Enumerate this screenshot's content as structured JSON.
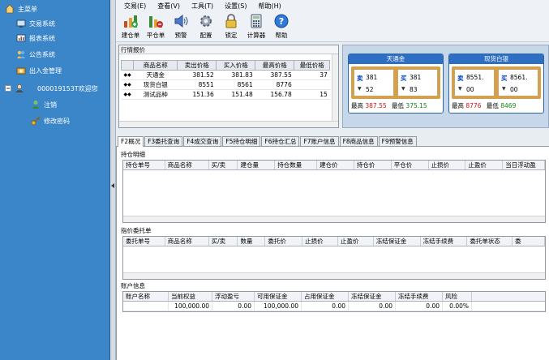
{
  "sidebar": {
    "items": [
      {
        "label": "主菜单"
      },
      {
        "label": "交易系统"
      },
      {
        "label": "报表系统"
      },
      {
        "label": "公告系统"
      },
      {
        "label": "出入金管理"
      },
      {
        "label": "000019153T欢迎您"
      },
      {
        "label": "注销"
      },
      {
        "label": "修改密码"
      }
    ]
  },
  "menu": {
    "items": [
      "交易(E)",
      "查看(V)",
      "工具(T)",
      "设置(S)",
      "帮助(H)"
    ]
  },
  "toolbar": {
    "buttons": [
      {
        "label": "建仓单"
      },
      {
        "label": "平仓单"
      },
      {
        "label": "预警"
      },
      {
        "label": "配置"
      },
      {
        "label": "锁定"
      },
      {
        "label": "计算器"
      },
      {
        "label": "帮助"
      }
    ]
  },
  "quotes": {
    "title": "行情报价",
    "headers": [
      "商品名称",
      "卖出价格",
      "买入价格",
      "最高价格",
      "最低价格"
    ],
    "rows": [
      {
        "mark": "◆◆",
        "name": "天通金",
        "sell": "381.52",
        "buy": "381.83",
        "high": "387.55",
        "low": "37"
      },
      {
        "mark": "◆◆",
        "name": "现货白银",
        "sell": "8551",
        "buy": "8561",
        "high": "8776",
        "low": ""
      },
      {
        "mark": "◆◆",
        "name": "测试品种",
        "sell": "151.36",
        "buy": "151.48",
        "high": "156.78",
        "low": "15"
      }
    ]
  },
  "cards": [
    {
      "title": "天通金",
      "sell_label": "卖",
      "sell": "381",
      "sell_vol": "52",
      "buy_label": "买",
      "buy": "381",
      "buy_vol": "83",
      "high_label": "最高",
      "high": "387.55",
      "low_label": "最低",
      "low": "375.15"
    },
    {
      "title": "现货白银",
      "sell_label": "卖",
      "sell": "8551.",
      "sell_vol": "00",
      "buy_label": "买",
      "buy": "8561.",
      "buy_vol": "00",
      "high_label": "最高",
      "high": "8776",
      "low_label": "最低",
      "low": "8469"
    }
  ],
  "tabs": [
    "F2概况",
    "F3委托查询",
    "F4成交查询",
    "F5持仓明细",
    "F6持仓汇总",
    "F7账户信息",
    "F8商品信息",
    "F9预警信息"
  ],
  "holdings": {
    "title": "持仓明细",
    "headers": [
      "持仓单号",
      "商品名称",
      "买/卖",
      "建仓量",
      "持仓数量",
      "建仓价",
      "持仓价",
      "平仓价",
      "止损价",
      "止盈价",
      "当日浮动盈"
    ]
  },
  "limit_orders": {
    "title": "指价委托单",
    "headers": [
      "委托单号",
      "商品名称",
      "买/卖",
      "数量",
      "委托价",
      "止损价",
      "止盈价",
      "冻结保证金",
      "冻结手续费",
      "委托单状态",
      "委"
    ]
  },
  "account": {
    "title": "账户信息",
    "headers": [
      "账户名称",
      "当前权益",
      "浮动盈亏",
      "可用保证金",
      "占用保证金",
      "冻结保证金",
      "冻结手续费",
      "风险"
    ],
    "row": [
      "",
      "100,000.00",
      "0.00",
      "100,000.00",
      "0.00",
      "0.00",
      "0.00",
      "0.00%"
    ]
  },
  "colors": {
    "nav_bg": "#3b86c8",
    "card_head": "#2f6fc3",
    "accent_red": "#d01010",
    "accent_green": "#108a10"
  }
}
